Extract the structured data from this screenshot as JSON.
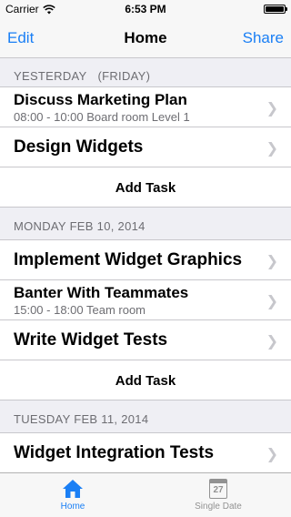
{
  "status_bar": {
    "carrier": "Carrier",
    "time": "6:53 PM",
    "icons": [
      "wifi-icon",
      "battery-icon"
    ]
  },
  "nav": {
    "left": "Edit",
    "title": "Home",
    "right": "Share"
  },
  "sections": [
    {
      "header": "YESTERDAY",
      "header_extra": "(FRIDAY)",
      "tasks": [
        {
          "title": "Discuss Marketing Plan",
          "subtitle": "08:00 - 10:00 Board room Level 1"
        },
        {
          "title": "Design Widgets",
          "subtitle": ""
        }
      ],
      "add": "Add Task"
    },
    {
      "header": "MONDAY FEB 10, 2014",
      "tasks": [
        {
          "title": "Implement Widget Graphics",
          "subtitle": ""
        },
        {
          "title": "Banter With Teammates",
          "subtitle": "15:00 - 18:00 Team room"
        },
        {
          "title": "Write Widget Tests",
          "subtitle": ""
        }
      ],
      "add": "Add Task"
    },
    {
      "header": "TUESDAY FEB 11, 2014",
      "tasks": [
        {
          "title": "Widget Integration Tests",
          "subtitle": ""
        }
      ]
    }
  ],
  "tab_bar": {
    "tabs": [
      {
        "label": "Home",
        "icon": "home-icon",
        "active": true
      },
      {
        "label": "Single Date",
        "icon": "calendar-icon",
        "icon_text": "27",
        "active": false
      }
    ]
  },
  "colors": {
    "accent": "#1a7ff5",
    "background": "#efeff4",
    "separator": "#c8c7cc",
    "secondary_text": "#6d6d72"
  }
}
